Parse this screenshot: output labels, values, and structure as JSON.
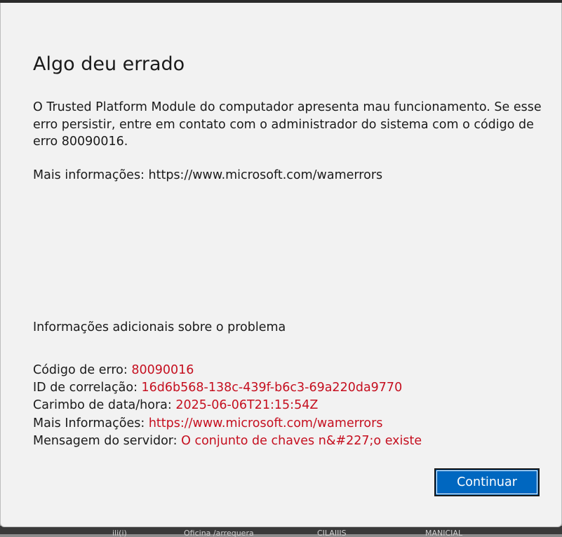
{
  "dialog": {
    "title": "Algo deu errado",
    "message": "O Trusted Platform Module do computador apresenta mau funcionamento. Se esse erro persistir, entre em contato com o administrador do sistema com o código de erro 80090016.",
    "more_info": "Mais informações: https://www.microsoft.com/wamerrors",
    "additional_heading": "Informações adicionais sobre o problema",
    "details": [
      {
        "label": "Código de erro: ",
        "value": "80090016"
      },
      {
        "label": "ID de correlação: ",
        "value": "16d6b568-138c-439f-b6c3-69a220da9770"
      },
      {
        "label": "Carimbo de data/hora: ",
        "value": "2025-06-06T21:15:54Z"
      },
      {
        "label": "Mais Informações: ",
        "value": "https://www.microsoft.com/wamerrors"
      },
      {
        "label": "Mensagem do servidor: ",
        "value": "O conjunto de chaves n&#227;o existe"
      }
    ],
    "continue_label": "Continuar"
  },
  "background_window": {
    "fragments": [
      "ili(i)",
      "Oficina /arrequera",
      "CILAIIIS",
      "MANICIAL"
    ]
  },
  "colors": {
    "dialog_bg": "#f2f2f2",
    "error_value": "#c50f1f",
    "button_bg": "#0067c0",
    "text": "#1a1a1a"
  }
}
